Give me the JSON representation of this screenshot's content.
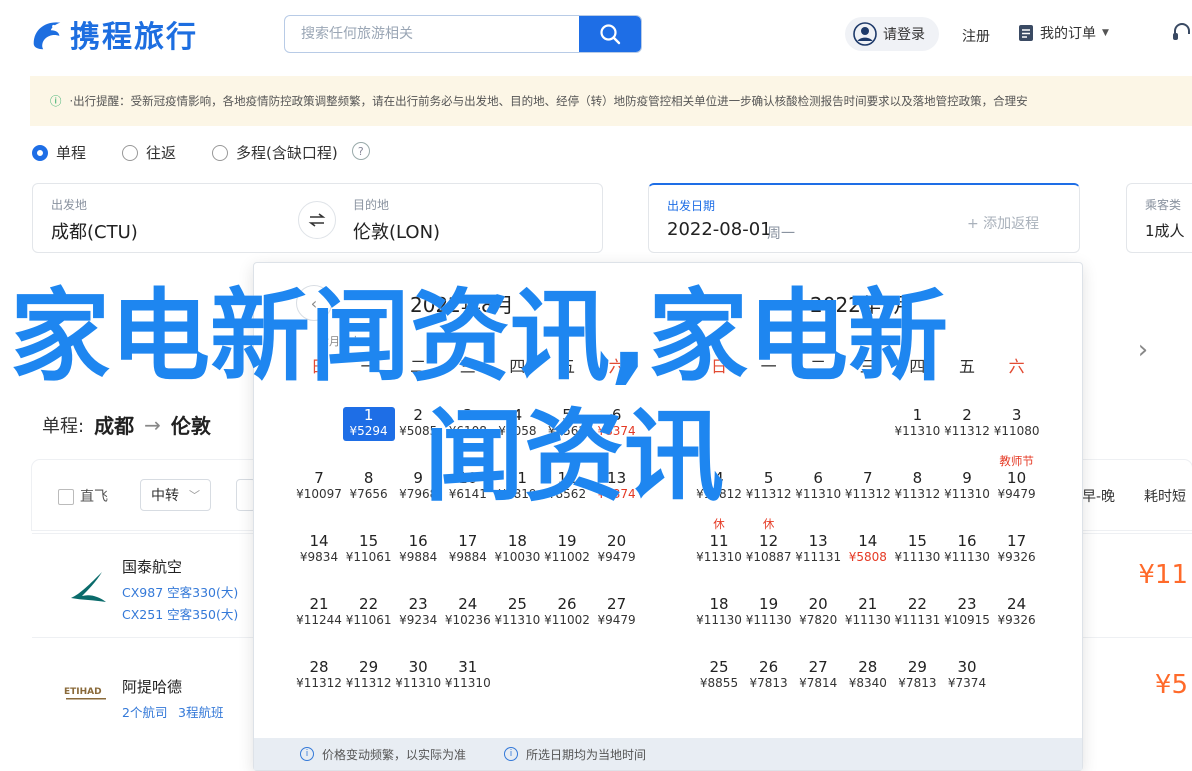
{
  "header": {
    "logo_text": "携程旅行",
    "search_placeholder": "搜索任何旅游相关",
    "login_label": "请登录",
    "register_label": "注册",
    "orders_label": "我的订单"
  },
  "notice": {
    "text": "·出行提醒：受新冠疫情影响，各地疫情防控政策调整频繁，请在出行前务必与出发地、目的地、经停（转）地防疫管控相关单位进一步确认核酸检测报告时间要求以及落地管控政策，合理安"
  },
  "trip_type": {
    "options": [
      "单程",
      "往返",
      "多程(含缺口程)"
    ],
    "selected": "单程",
    "help": "?"
  },
  "search": {
    "from_label": "出发地",
    "from_value": "成都(CTU)",
    "to_label": "目的地",
    "to_value": "伦敦(LON)",
    "date_label": "出发日期",
    "date_value": "2022-08-01",
    "date_weekday": "周一",
    "add_return": "+ 添加返程",
    "pax_label": "乘客类",
    "pax_value": "1成人"
  },
  "route": {
    "prefix": "单程:",
    "from": "成都",
    "to": "伦敦"
  },
  "filters": {
    "direct": "直飞",
    "transfer": "中转",
    "sort_early_late": "早-晚",
    "sort_duration": "耗时短"
  },
  "flights": [
    {
      "airline": "国泰航空",
      "line1": "CX987 空客330(大)",
      "line2": "CX251 空客350(大)",
      "price": "¥11"
    },
    {
      "airline": "阿提哈德",
      "line1": "2个航司",
      "line2": "3程航班",
      "price": "¥5"
    }
  ],
  "calendar": {
    "left_title": "2022年8月",
    "right_title": "2022年9月",
    "left_lunar": "七月廿九",
    "weekdays": [
      "日",
      "一",
      "二",
      "三",
      "四",
      "五",
      "六"
    ],
    "august": [
      {
        "d": "1",
        "p": "¥5294",
        "sel": true
      },
      {
        "d": "2",
        "p": "¥5085"
      },
      {
        "d": "3",
        "p": "¥6108"
      },
      {
        "d": "4",
        "p": "¥5058"
      },
      {
        "d": "5",
        "p": "¥8562"
      },
      {
        "d": "6",
        "p": "¥8374",
        "low": true
      },
      {
        "d": "7",
        "p": "¥10097"
      },
      {
        "d": "8",
        "p": "¥7656"
      },
      {
        "d": "9",
        "p": "¥7968"
      },
      {
        "d": "10",
        "p": "¥6141"
      },
      {
        "d": "11",
        "p": "¥7819"
      },
      {
        "d": "12",
        "p": "¥8562"
      },
      {
        "d": "13",
        "p": "¥8374",
        "low": true
      },
      {
        "d": "14",
        "p": "¥9834"
      },
      {
        "d": "15",
        "p": "¥11061"
      },
      {
        "d": "16",
        "p": "¥9884"
      },
      {
        "d": "17",
        "p": "¥9884"
      },
      {
        "d": "18",
        "p": "¥10030"
      },
      {
        "d": "19",
        "p": "¥11002"
      },
      {
        "d": "20",
        "p": "¥9479"
      },
      {
        "d": "21",
        "p": "¥11244"
      },
      {
        "d": "22",
        "p": "¥11061"
      },
      {
        "d": "23",
        "p": "¥9234"
      },
      {
        "d": "24",
        "p": "¥10236"
      },
      {
        "d": "25",
        "p": "¥11310"
      },
      {
        "d": "26",
        "p": "¥11002"
      },
      {
        "d": "27",
        "p": "¥9479"
      },
      {
        "d": "28",
        "p": "¥11312"
      },
      {
        "d": "29",
        "p": "¥11312"
      },
      {
        "d": "30",
        "p": "¥11310"
      },
      {
        "d": "31",
        "p": "¥11310"
      }
    ],
    "september": [
      {
        "d": "1",
        "p": "¥11310"
      },
      {
        "d": "2",
        "p": "¥11312"
      },
      {
        "d": "3",
        "p": "¥11080"
      },
      {
        "d": "4",
        "p": "¥11812"
      },
      {
        "d": "5",
        "p": "¥11312"
      },
      {
        "d": "6",
        "p": "¥11310"
      },
      {
        "d": "7",
        "p": "¥11312"
      },
      {
        "d": "8",
        "p": "¥11312"
      },
      {
        "d": "9",
        "p": "¥11310"
      },
      {
        "d": "10",
        "p": "¥9479",
        "h": "教师节"
      },
      {
        "d": "11",
        "p": "¥11310",
        "h": "休"
      },
      {
        "d": "12",
        "p": "¥10887",
        "h": "休"
      },
      {
        "d": "13",
        "p": "¥11131"
      },
      {
        "d": "14",
        "p": "¥5808",
        "low": true
      },
      {
        "d": "15",
        "p": "¥11130"
      },
      {
        "d": "16",
        "p": "¥11130"
      },
      {
        "d": "17",
        "p": "¥9326"
      },
      {
        "d": "18",
        "p": "¥11130"
      },
      {
        "d": "19",
        "p": "¥11130"
      },
      {
        "d": "20",
        "p": "¥7820"
      },
      {
        "d": "21",
        "p": "¥11130"
      },
      {
        "d": "22",
        "p": "¥11131"
      },
      {
        "d": "23",
        "p": "¥10915"
      },
      {
        "d": "24",
        "p": "¥9326"
      },
      {
        "d": "25",
        "p": "¥8855"
      },
      {
        "d": "26",
        "p": "¥7813"
      },
      {
        "d": "27",
        "p": "¥7814"
      },
      {
        "d": "28",
        "p": "¥8340"
      },
      {
        "d": "29",
        "p": "¥7813"
      },
      {
        "d": "30",
        "p": "¥7374"
      }
    ],
    "footer_1": "价格变动频繁，以实际为准",
    "footer_2": "所选日期均为当地时间"
  },
  "overlay": {
    "line1": "家电新闻资讯,家电新",
    "line2": "闻资讯"
  },
  "colors": {
    "brand": "#1e6ee6",
    "overlay": "#1e86f0",
    "price": "#ff6a2a",
    "notice_bg": "#fcf6e6"
  }
}
